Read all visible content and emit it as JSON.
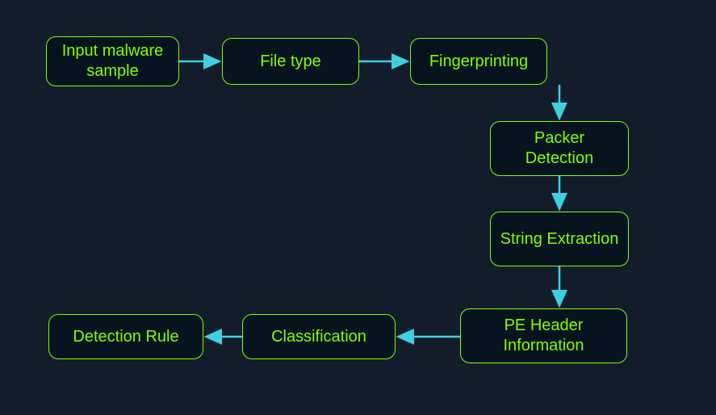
{
  "diagram": {
    "nodes": {
      "input_malware": "Input malware sample",
      "file_type": "File type",
      "fingerprinting": "Fingerprinting",
      "packer_detection": "Packer Detection",
      "string_extraction": "String Extraction",
      "pe_header_info": "PE Header Information",
      "classification": "Classification",
      "detection_rule": "Detection Rule"
    },
    "flow_order": [
      "input_malware",
      "file_type",
      "fingerprinting",
      "packer_detection",
      "string_extraction",
      "pe_header_info",
      "classification",
      "detection_rule"
    ],
    "colors": {
      "background": "#121c2a",
      "node_border": "#7fff00",
      "node_fill": "#07141f",
      "node_text": "#7fff00",
      "arrow": "#3ed0e0"
    }
  }
}
